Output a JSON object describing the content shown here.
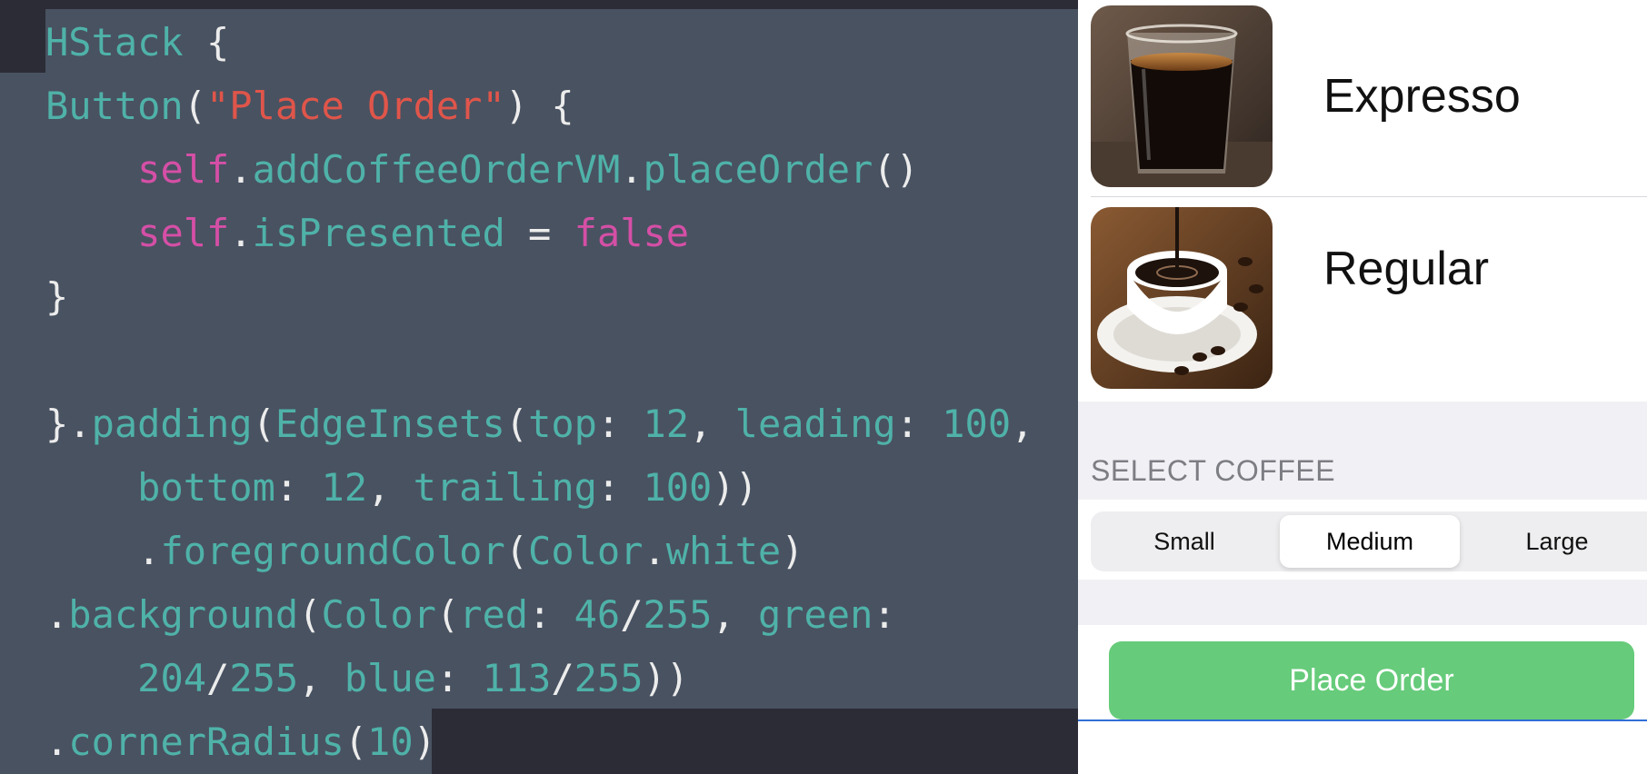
{
  "editor": {
    "lines": [
      [
        {
          "t": "HStack",
          "c": "id"
        },
        {
          "t": " {",
          "c": "pl"
        }
      ],
      [
        {
          "t": "Button",
          "c": "id"
        },
        {
          "t": "(",
          "c": "pl"
        },
        {
          "t": "\"Place Order\"",
          "c": "str"
        },
        {
          "t": ") {",
          "c": "pl"
        }
      ],
      [
        {
          "t": "    ",
          "c": "pl"
        },
        {
          "t": "self",
          "c": "kw"
        },
        {
          "t": ".",
          "c": "pl"
        },
        {
          "t": "addCoffeeOrderVM",
          "c": "id"
        },
        {
          "t": ".",
          "c": "pl"
        },
        {
          "t": "placeOrder",
          "c": "id"
        },
        {
          "t": "()",
          "c": "pl"
        }
      ],
      [
        {
          "t": "    ",
          "c": "pl"
        },
        {
          "t": "self",
          "c": "kw"
        },
        {
          "t": ".",
          "c": "pl"
        },
        {
          "t": "isPresented",
          "c": "id"
        },
        {
          "t": " = ",
          "c": "pl"
        },
        {
          "t": "false",
          "c": "kw"
        }
      ],
      [
        {
          "t": "}",
          "c": "pl"
        }
      ],
      [
        {
          "t": "",
          "c": "pl"
        }
      ],
      [
        {
          "t": "}.",
          "c": "pl"
        },
        {
          "t": "padding",
          "c": "id"
        },
        {
          "t": "(",
          "c": "pl"
        },
        {
          "t": "EdgeInsets",
          "c": "id"
        },
        {
          "t": "(",
          "c": "pl"
        },
        {
          "t": "top",
          "c": "id"
        },
        {
          "t": ": ",
          "c": "pl"
        },
        {
          "t": "12",
          "c": "num"
        },
        {
          "t": ", ",
          "c": "pl"
        },
        {
          "t": "leading",
          "c": "id"
        },
        {
          "t": ": ",
          "c": "pl"
        },
        {
          "t": "100",
          "c": "num"
        },
        {
          "t": ",",
          "c": "pl"
        }
      ],
      [
        {
          "t": "    ",
          "c": "pl"
        },
        {
          "t": "bottom",
          "c": "id"
        },
        {
          "t": ": ",
          "c": "pl"
        },
        {
          "t": "12",
          "c": "num"
        },
        {
          "t": ", ",
          "c": "pl"
        },
        {
          "t": "trailing",
          "c": "id"
        },
        {
          "t": ": ",
          "c": "pl"
        },
        {
          "t": "100",
          "c": "num"
        },
        {
          "t": "))",
          "c": "pl"
        }
      ],
      [
        {
          "t": "    .",
          "c": "pl"
        },
        {
          "t": "foregroundColor",
          "c": "id"
        },
        {
          "t": "(",
          "c": "pl"
        },
        {
          "t": "Color",
          "c": "id"
        },
        {
          "t": ".",
          "c": "pl"
        },
        {
          "t": "white",
          "c": "id"
        },
        {
          "t": ")",
          "c": "pl"
        }
      ],
      [
        {
          "t": ".",
          "c": "pl"
        },
        {
          "t": "background",
          "c": "id"
        },
        {
          "t": "(",
          "c": "pl"
        },
        {
          "t": "Color",
          "c": "id"
        },
        {
          "t": "(",
          "c": "pl"
        },
        {
          "t": "red",
          "c": "id"
        },
        {
          "t": ": ",
          "c": "pl"
        },
        {
          "t": "46",
          "c": "num"
        },
        {
          "t": "/",
          "c": "pl"
        },
        {
          "t": "255",
          "c": "num"
        },
        {
          "t": ", ",
          "c": "pl"
        },
        {
          "t": "green",
          "c": "id"
        },
        {
          "t": ":",
          "c": "pl"
        }
      ],
      [
        {
          "t": "    ",
          "c": "pl"
        },
        {
          "t": "204",
          "c": "num"
        },
        {
          "t": "/",
          "c": "pl"
        },
        {
          "t": "255",
          "c": "num"
        },
        {
          "t": ", ",
          "c": "pl"
        },
        {
          "t": "blue",
          "c": "id"
        },
        {
          "t": ": ",
          "c": "pl"
        },
        {
          "t": "113",
          "c": "num"
        },
        {
          "t": "/",
          "c": "pl"
        },
        {
          "t": "255",
          "c": "num"
        },
        {
          "t": "))",
          "c": "pl"
        }
      ],
      [
        {
          "t": ".",
          "c": "pl"
        },
        {
          "t": "cornerRadius",
          "c": "id"
        },
        {
          "t": "(",
          "c": "pl"
        },
        {
          "t": "10",
          "c": "num"
        },
        {
          "t": ")",
          "c": "pl"
        }
      ]
    ]
  },
  "preview": {
    "coffees": [
      {
        "name": "Expresso",
        "image": "espresso-glass-photo"
      },
      {
        "name": "Regular",
        "image": "coffee-cup-saucer-photo"
      }
    ],
    "section_header": "SELECT COFFEE",
    "sizes": [
      {
        "label": "Small",
        "selected": false
      },
      {
        "label": "Medium",
        "selected": true
      },
      {
        "label": "Large",
        "selected": false
      }
    ],
    "place_order_label": "Place Order",
    "button_color": "#66cb7a"
  }
}
